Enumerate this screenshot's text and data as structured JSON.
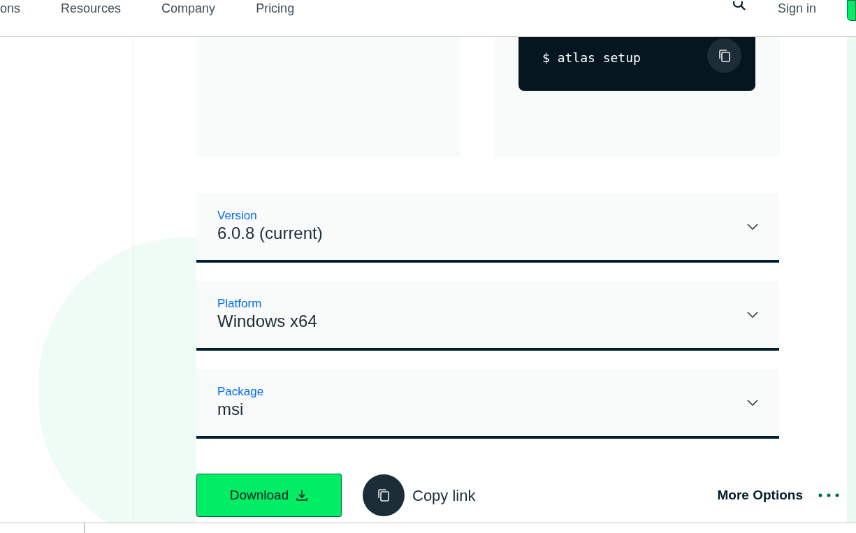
{
  "nav": {
    "items": [
      "ons",
      "Resources",
      "Company",
      "Pricing"
    ],
    "sign_in": "Sign in"
  },
  "command": "$ atlas setup",
  "selects": [
    {
      "label": "Version",
      "value": "6.0.8 (current)"
    },
    {
      "label": "Platform",
      "value": "Windows x64"
    },
    {
      "label": "Package",
      "value": "msi"
    }
  ],
  "download": "Download",
  "copy_link": "Copy link",
  "more_options": "More Options"
}
